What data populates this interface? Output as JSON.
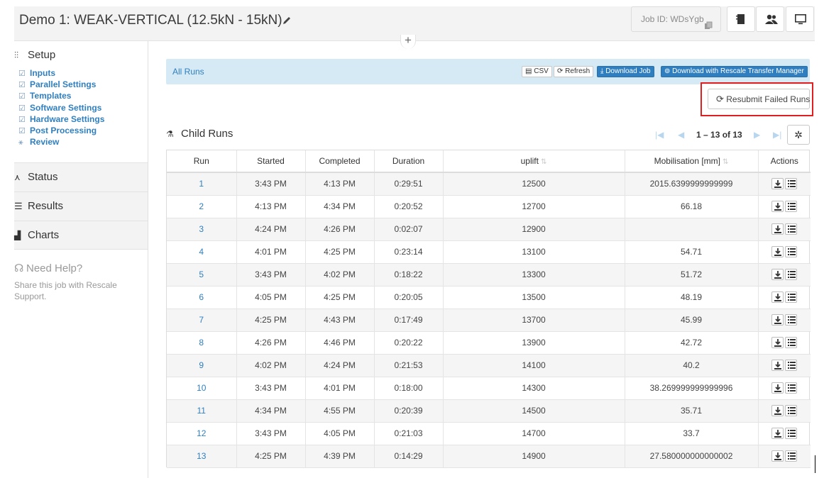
{
  "header": {
    "title": "Demo 1: WEAK-VERTICAL (12.5kN - 15kN)",
    "job_id": "Job ID: WDsYgb",
    "add_tab": "+"
  },
  "sidebar": {
    "setup": {
      "label": "Setup",
      "items": [
        {
          "label": "Inputs"
        },
        {
          "label": "Parallel Settings"
        },
        {
          "label": "Templates"
        },
        {
          "label": "Software Settings"
        },
        {
          "label": "Hardware Settings"
        },
        {
          "label": "Post Processing"
        },
        {
          "label": "Review"
        }
      ]
    },
    "status": "Status",
    "results": "Results",
    "charts": "Charts",
    "help": {
      "title": "Need Help?",
      "text": "Share this job with Rescale Support."
    }
  },
  "runs_bar": {
    "title": "All Runs",
    "csv": "CSV",
    "refresh": "Refresh",
    "download_job": "Download Job",
    "download_transfer": "Download with Rescale Transfer Manager"
  },
  "resubmit": "Resubmit Failed Runs",
  "child_runs": {
    "title": "Child Runs",
    "pager": "1 – 13 of 13"
  },
  "table": {
    "headers": {
      "run": "Run",
      "started": "Started",
      "completed": "Completed",
      "duration": "Duration",
      "uplift": "uplift",
      "mobilisation": "Mobilisation [mm]",
      "actions": "Actions"
    },
    "rows": [
      {
        "run": "1",
        "started": "3:43 PM",
        "completed": "4:13 PM",
        "duration": "0:29:51",
        "uplift": "12500",
        "mob": "2015.6399999999999"
      },
      {
        "run": "2",
        "started": "4:13 PM",
        "completed": "4:34 PM",
        "duration": "0:20:52",
        "uplift": "12700",
        "mob": "66.18"
      },
      {
        "run": "3",
        "started": "4:24 PM",
        "completed": "4:26 PM",
        "duration": "0:02:07",
        "uplift": "12900",
        "mob": ""
      },
      {
        "run": "4",
        "started": "4:01 PM",
        "completed": "4:25 PM",
        "duration": "0:23:14",
        "uplift": "13100",
        "mob": "54.71"
      },
      {
        "run": "5",
        "started": "3:43 PM",
        "completed": "4:02 PM",
        "duration": "0:18:22",
        "uplift": "13300",
        "mob": "51.72"
      },
      {
        "run": "6",
        "started": "4:05 PM",
        "completed": "4:25 PM",
        "duration": "0:20:05",
        "uplift": "13500",
        "mob": "48.19"
      },
      {
        "run": "7",
        "started": "4:25 PM",
        "completed": "4:43 PM",
        "duration": "0:17:49",
        "uplift": "13700",
        "mob": "45.99"
      },
      {
        "run": "8",
        "started": "4:26 PM",
        "completed": "4:46 PM",
        "duration": "0:20:22",
        "uplift": "13900",
        "mob": "42.72"
      },
      {
        "run": "9",
        "started": "4:02 PM",
        "completed": "4:24 PM",
        "duration": "0:21:53",
        "uplift": "14100",
        "mob": "40.2"
      },
      {
        "run": "10",
        "started": "3:43 PM",
        "completed": "4:01 PM",
        "duration": "0:18:00",
        "uplift": "14300",
        "mob": "38.269999999999996"
      },
      {
        "run": "11",
        "started": "4:34 PM",
        "completed": "4:55 PM",
        "duration": "0:20:39",
        "uplift": "14500",
        "mob": "35.71"
      },
      {
        "run": "12",
        "started": "3:43 PM",
        "completed": "4:05 PM",
        "duration": "0:21:03",
        "uplift": "14700",
        "mob": "33.7"
      },
      {
        "run": "13",
        "started": "4:25 PM",
        "completed": "4:39 PM",
        "duration": "0:14:29",
        "uplift": "14900",
        "mob": "27.580000000000002"
      }
    ]
  },
  "colors": {
    "link": "#2f7fc0",
    "bar_bg": "#d6eaf5",
    "highlight": "#e02020"
  }
}
